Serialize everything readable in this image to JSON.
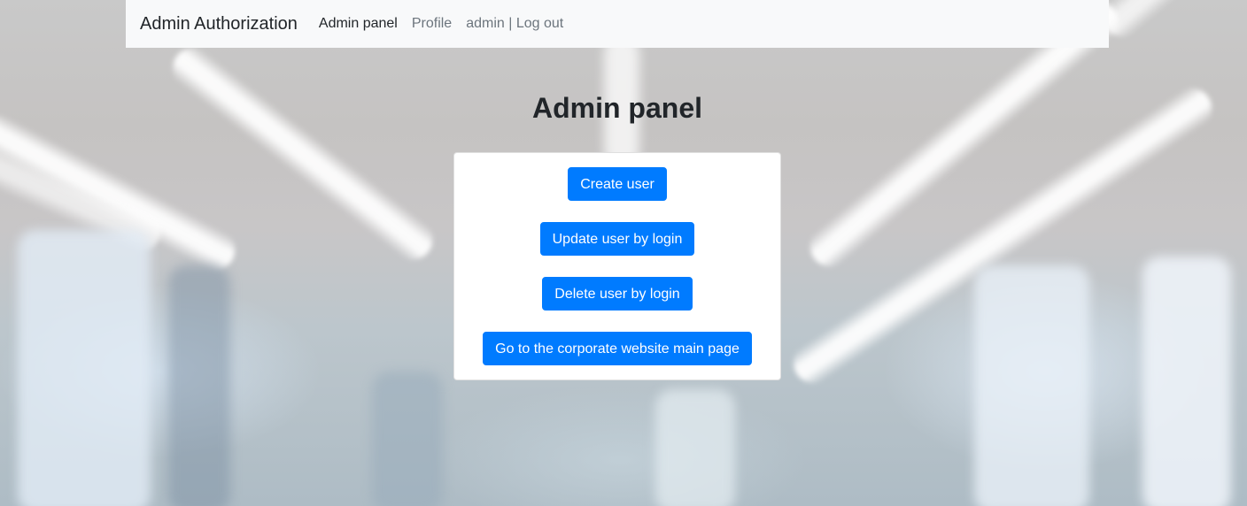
{
  "navbar": {
    "brand": "Admin Authorization",
    "links": [
      {
        "label": "Admin panel",
        "active": true
      },
      {
        "label": "Profile",
        "active": false
      },
      {
        "label": "admin | Log out",
        "active": false
      }
    ]
  },
  "main": {
    "title": "Admin panel",
    "buttons": [
      {
        "label": "Create user"
      },
      {
        "label": "Update user by login"
      },
      {
        "label": "Delete user by login"
      },
      {
        "label": "Go to the corporate website main page"
      }
    ]
  },
  "colors": {
    "primary": "#007bff",
    "navbar_bg": "#f8f9fa",
    "text_dark": "#212529",
    "text_muted": "#6c757d"
  }
}
